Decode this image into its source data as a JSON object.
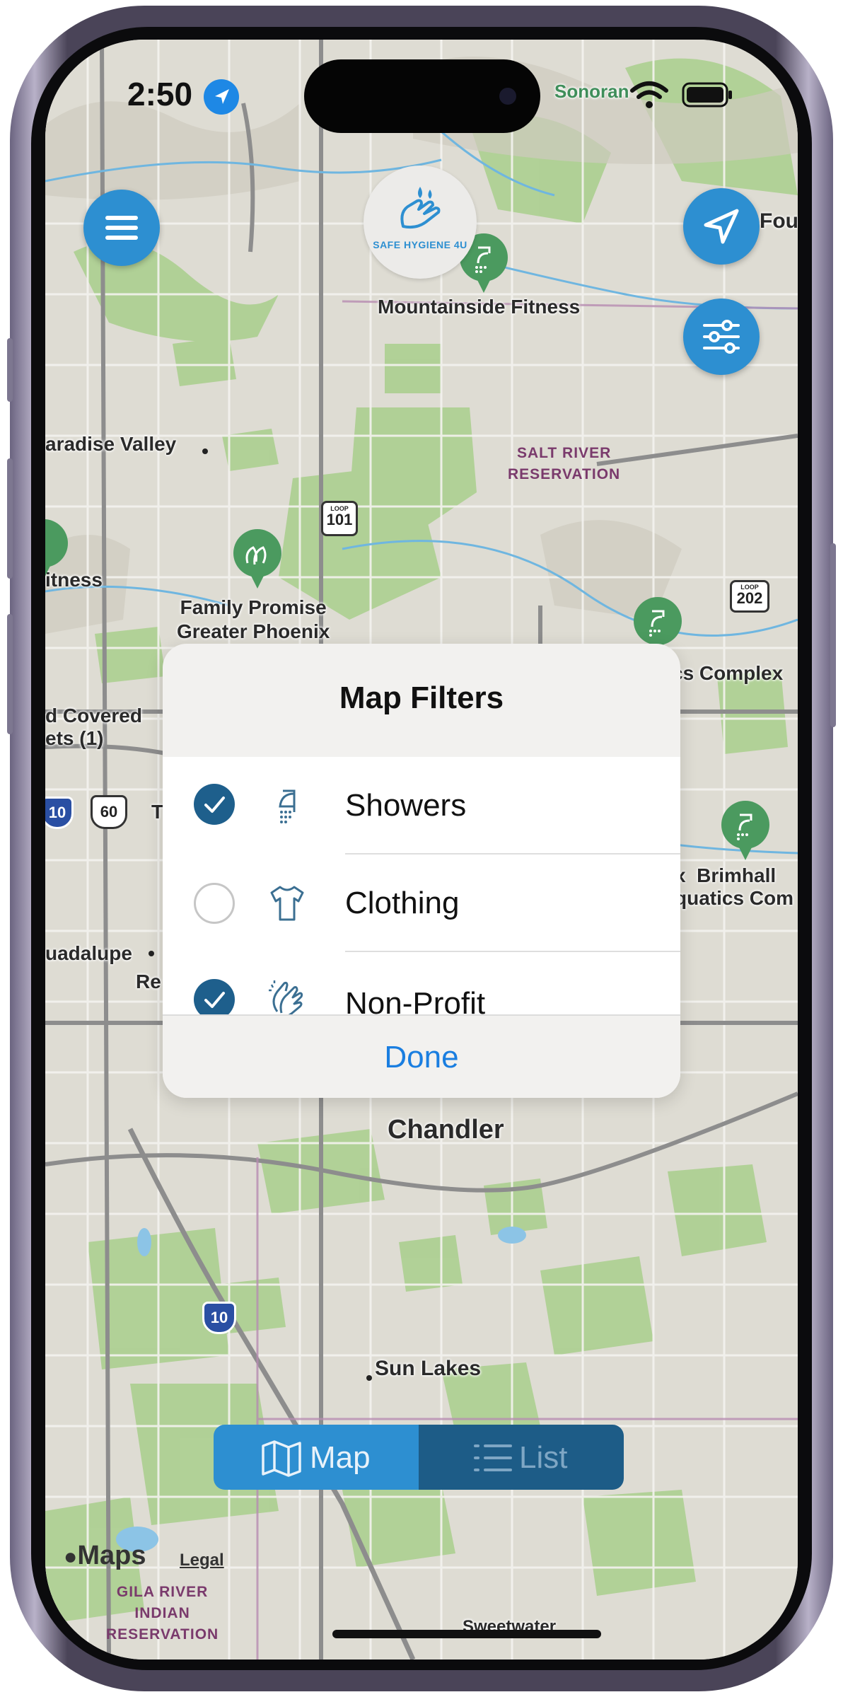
{
  "status_bar": {
    "time": "2:50"
  },
  "header": {
    "logo_text": "SAFE HYGIENE 4U"
  },
  "map": {
    "labels": {
      "fountain_partial": "Fou",
      "sonoran_partial": "Sonoran",
      "mountainside": "Mountainside Fitness",
      "paradise_valley": "aradise Valley",
      "salt_river": "SALT RIVER\nRESERVATION",
      "fitness_partial": "itness",
      "family_promise": "Family Promise\nGreater Phoenix",
      "complex_partial": "cs Complex",
      "covered_partial": "d Covered\nets (1)",
      "t_partial": "T",
      "brimhall": "x  Brimhall\nquatics Com",
      "guadalupe": "uadalupe",
      "re_partial": "Re",
      "chandler": "Chandler",
      "sun_lakes": "Sun Lakes",
      "maps_brand": "Maps",
      "legal": "Legal",
      "gila_river": "GILA RIVER\nINDIAN\nRESERVATION",
      "sweetwater": "Sweetwater"
    },
    "shields": {
      "loop101": "101",
      "loop202": "202",
      "i10_a": "10",
      "us60": "60",
      "i10_b": "10",
      "loop_word": "LOOP"
    }
  },
  "dialog": {
    "title": "Map Filters",
    "items": [
      {
        "label": "Showers",
        "checked": true,
        "icon": "shower-icon"
      },
      {
        "label": "Clothing",
        "checked": false,
        "icon": "tshirt-icon"
      },
      {
        "label": "Non-Profit",
        "checked": true,
        "icon": "hands-icon"
      }
    ],
    "done_label": "Done"
  },
  "bottom_toggle": {
    "map_label": "Map",
    "list_label": "List",
    "selected": "Map"
  },
  "colors": {
    "accent": "#2d8fd1",
    "accent_dark": "#1d5c87",
    "check": "#1e5f8c",
    "pin": "#4b9a5f",
    "done": "#1a7ee0"
  }
}
